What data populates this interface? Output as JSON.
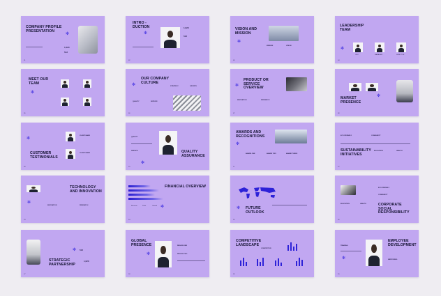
{
  "common": {
    "header_left": "Business Brand",
    "header_right": "Your Company"
  },
  "slides": [
    {
      "id": 1,
      "title": "COMPANY PROFILE PRESENTATION",
      "page": "01"
    },
    {
      "id": 2,
      "title": "INTRO - DUCTION",
      "page": "02"
    },
    {
      "id": 3,
      "title": "VISION AND MISSION",
      "page": "03"
    },
    {
      "id": 4,
      "title": "LEADERSHIP TEAM",
      "page": "04"
    },
    {
      "id": 5,
      "title": "MEET OUR TEAM",
      "page": "05"
    },
    {
      "id": 6,
      "title": "OUR COMPANY CULTURE",
      "page": "06"
    },
    {
      "id": 7,
      "title": "PRODUCT OR SERVICE OVERVIEW",
      "page": "07"
    },
    {
      "id": 8,
      "title": "MARKET PRESENCE",
      "page": "08"
    },
    {
      "id": 9,
      "title": "CUSTOMER TESTIMONIALS",
      "page": "09"
    },
    {
      "id": 10,
      "title": "QUALITY ASSURANCE",
      "page": "10"
    },
    {
      "id": 11,
      "title": "AWARDS AND RECOGNITIONS",
      "page": "11"
    },
    {
      "id": 12,
      "title": "SUSTAINABILITY INITIATIVES",
      "page": "12"
    },
    {
      "id": 13,
      "title": "TECHNOLOGY AND INNOVATION",
      "page": "13"
    },
    {
      "id": 14,
      "title": "FINANCIAL OVERVIEW",
      "page": "14"
    },
    {
      "id": 15,
      "title": "FUTURE OUTLOOK",
      "page": "15"
    },
    {
      "id": 16,
      "title": "CORPORATE SOCIAL RESPONSIBILITY",
      "page": "16"
    },
    {
      "id": 17,
      "title": "STRATEGIC PARTNERSHIP",
      "page": "17"
    },
    {
      "id": 18,
      "title": "GLOBAL PRESENCE",
      "page": "18"
    },
    {
      "id": 19,
      "title": "COMPETITIVE LANDSCAPE",
      "page": "19"
    },
    {
      "id": 20,
      "title": "EMPLOYEE DEVELOPMENT",
      "page": "20"
    }
  ],
  "stats": {
    "s1_a": "1,020",
    "s1_b": "512",
    "s2_a": "1,020",
    "s2_b": "512",
    "s17_a": "512",
    "s17_b": "1,020"
  },
  "labels": {
    "project_one": "PROJECT ONE",
    "project_two": "PROJECT TWO",
    "mission": "MISSION",
    "vision": "VISION",
    "ceo": "CEO",
    "manager": "MANAGER",
    "director": "DIRECTOR",
    "client": "CLIENT NAME",
    "strategy": "STRATEGY",
    "growth": "GROWTH",
    "quality": "QUALITY",
    "service": "SERVICE",
    "innovation": "INNOVATION",
    "research": "RESEARCH",
    "award_one": "AWARD ONE",
    "award_two": "AWARD TWO",
    "award_three": "AWARD THREE",
    "eco": "ECO FRIENDLY",
    "community": "COMMUNITY",
    "education": "EDUCATION",
    "health": "HEALTH",
    "partner": "PARTNER",
    "region_one": "REGION ONE",
    "region_two": "REGION TWO",
    "competitor": "COMPETITOR",
    "training": "TRAINING",
    "mentoring": "MENTORING"
  },
  "legend": {
    "a": "Revenue",
    "b": "Profit",
    "c": "Growth"
  },
  "colors": {
    "slide_bg": "#c1a7f1",
    "accent": "#2d22d8",
    "text": "#141232",
    "page_bg": "#efedf2"
  }
}
